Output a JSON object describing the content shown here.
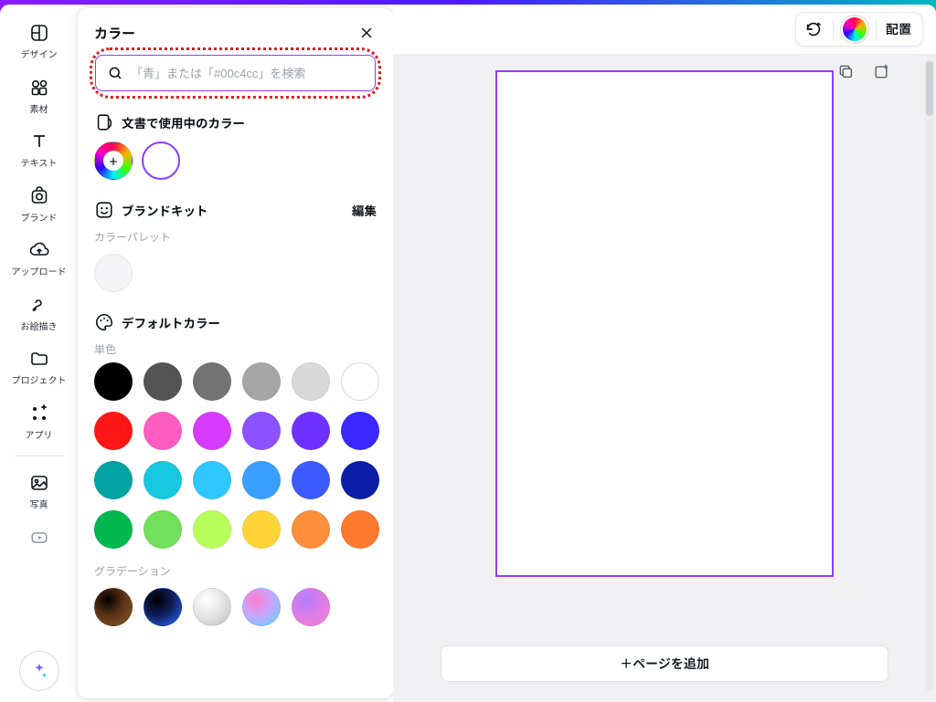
{
  "rail": {
    "items": [
      {
        "key": "design",
        "label": "デザイン"
      },
      {
        "key": "elements",
        "label": "素材"
      },
      {
        "key": "text",
        "label": "テキスト"
      },
      {
        "key": "brand",
        "label": "ブランド"
      },
      {
        "key": "uploads",
        "label": "アップロード"
      },
      {
        "key": "draw",
        "label": "お絵描き"
      },
      {
        "key": "projects",
        "label": "プロジェクト"
      },
      {
        "key": "apps",
        "label": "アプリ"
      },
      {
        "key": "photos",
        "label": "写真"
      }
    ]
  },
  "panel": {
    "title": "カラー",
    "search_placeholder": "「青」または「#00c4cc」を検索",
    "doc_colors_label": "文書で使用中のカラー",
    "brandkit_label": "ブランドキット",
    "brandkit_edit": "編集",
    "brandkit_sub": "カラーパレット",
    "default_label": "デフォルトカラー",
    "solid_sub": "単色",
    "gradient_sub": "グラデーション",
    "solid_colors": [
      "#000000",
      "#545454",
      "#737373",
      "#a6a6a6",
      "#d9d9d9",
      "#ffffff",
      "#ff1717",
      "#ff5ec0",
      "#d63bff",
      "#8c52ff",
      "#6d32ff",
      "#3b28ff",
      "#00a3a3",
      "#18c7e0",
      "#2ec8ff",
      "#3aa0ff",
      "#3b5bff",
      "#0b1ea8",
      "#00b84d",
      "#73e05b",
      "#b8ff5b",
      "#ffd438",
      "#ff8f3a",
      "#ff7a2e"
    ],
    "gradient_colors": [
      {
        "from": "#000000",
        "to": "#8a5a2e",
        "mid": "#5a3315"
      },
      {
        "from": "#000000",
        "to": "#2b6dff",
        "mid": "#0e1e5a"
      },
      {
        "from": "#ffffff",
        "to": "#bfbfbf",
        "mid": "#e6e6e6"
      },
      {
        "from": "#ff79c9",
        "to": "#5ad6ff",
        "mid": "#c8a6ff"
      },
      {
        "from": "#b67dff",
        "to": "#ff7dcf",
        "mid": "#d87de8"
      }
    ]
  },
  "toolbar": {
    "arrange": "配置"
  },
  "canvas": {
    "add_page": "＋ページを追加"
  }
}
